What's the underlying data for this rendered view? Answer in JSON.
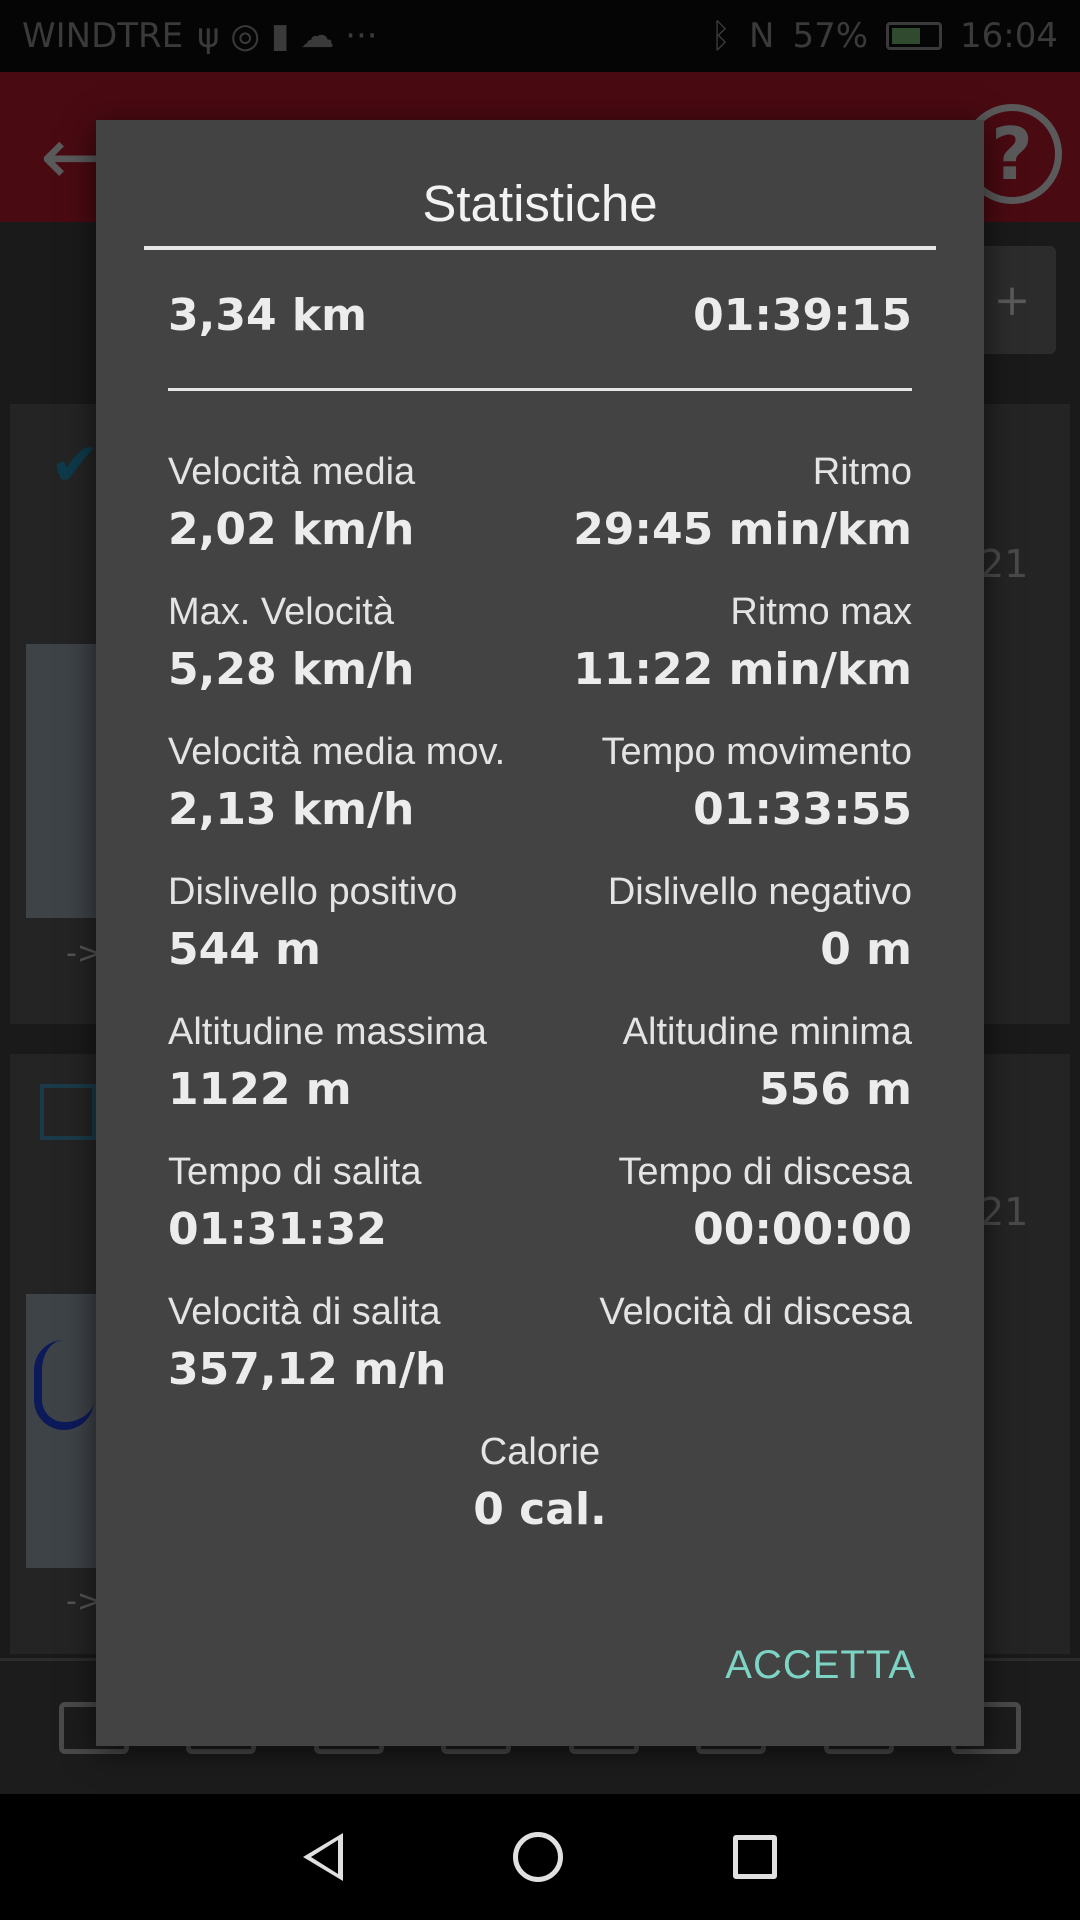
{
  "status_bar": {
    "carrier": "WINDTRE",
    "battery": "57%",
    "time": "16:04"
  },
  "background": {
    "add_label": "+",
    "date_suffix_1": "21",
    "date_suffix_2": "21",
    "arrow_1": "->",
    "arrow_2": "->"
  },
  "dialog": {
    "title": "Statistiche",
    "distance": "3,34 km",
    "duration": "01:39:15",
    "stats": [
      {
        "left_label": "Velocità media",
        "left_value": "2,02 km/h",
        "right_label": "Ritmo",
        "right_value": "29:45 min/km"
      },
      {
        "left_label": "Max. Velocità",
        "left_value": "5,28 km/h",
        "right_label": "Ritmo max",
        "right_value": "11:22 min/km"
      },
      {
        "left_label": "Velocità media mov.",
        "left_value": "2,13 km/h",
        "right_label": "Tempo movimento",
        "right_value": "01:33:55"
      },
      {
        "left_label": "Dislivello positivo",
        "left_value": "544 m",
        "right_label": "Dislivello negativo",
        "right_value": "0 m"
      },
      {
        "left_label": "Altitudine massima",
        "left_value": "1122 m",
        "right_label": "Altitudine minima",
        "right_value": "556 m"
      },
      {
        "left_label": "Tempo di salita",
        "left_value": "01:31:32",
        "right_label": "Tempo di discesa",
        "right_value": "00:00:00"
      },
      {
        "left_label": "Velocità di salita",
        "left_value": "357,12 m/h",
        "right_label": "Velocità di discesa",
        "right_value": ""
      }
    ],
    "calories_label": "Calorie",
    "calories_value": "0 cal.",
    "accept_label": "ACCETTA",
    "accent_color": "#7ed4c4"
  }
}
